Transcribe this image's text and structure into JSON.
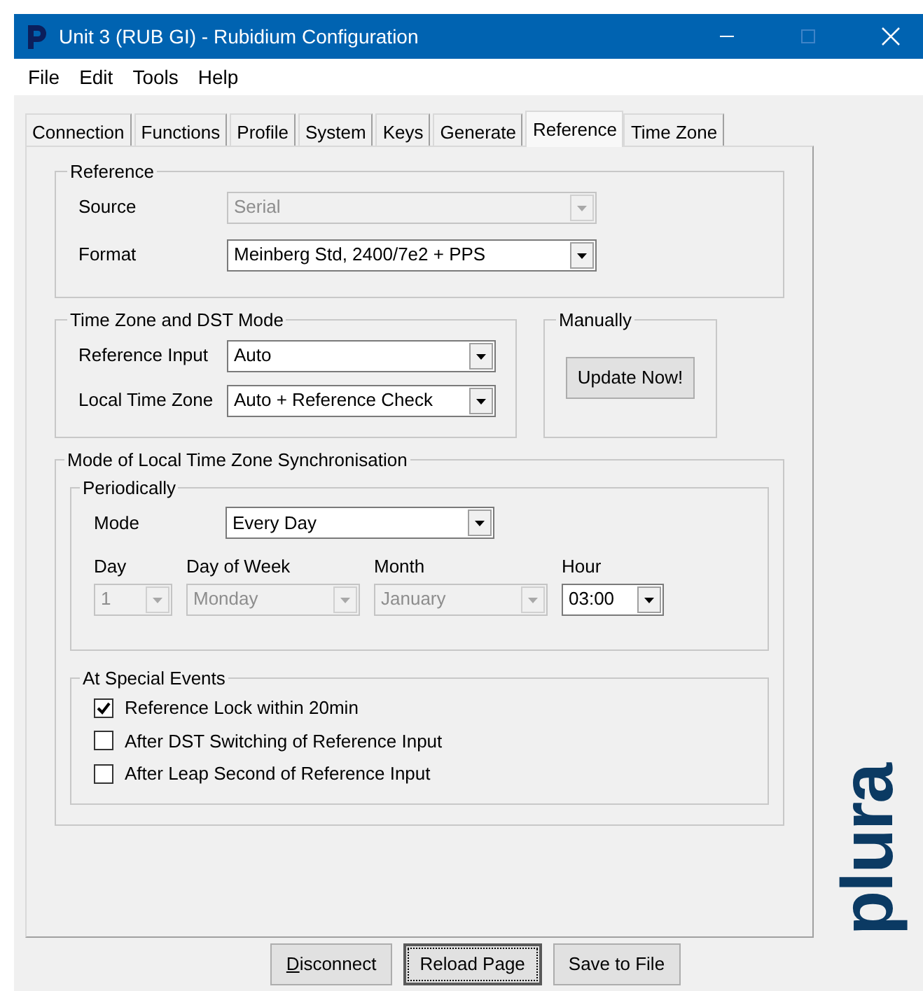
{
  "window": {
    "title": "Unit 3 (RUB GI) - Rubidium Configuration"
  },
  "menu": [
    "File",
    "Edit",
    "Tools",
    "Help"
  ],
  "tabs": [
    {
      "label": "Connection",
      "selected": false
    },
    {
      "label": "Functions",
      "selected": false
    },
    {
      "label": "Profile",
      "selected": false
    },
    {
      "label": "System",
      "selected": false
    },
    {
      "label": "Keys",
      "selected": false
    },
    {
      "label": "Generate",
      "selected": false
    },
    {
      "label": "Reference",
      "selected": true
    },
    {
      "label": "Time Zone",
      "selected": false
    }
  ],
  "reference": {
    "title": "Reference",
    "fields": [
      {
        "label": "Source",
        "value": "Serial",
        "disabled": true
      },
      {
        "label": "Format",
        "value": "Meinberg Std, 2400/7e2 + PPS",
        "disabled": false
      }
    ]
  },
  "time_zone_dst": {
    "title": "Time Zone and DST Mode",
    "fields": [
      {
        "label": "Reference Input",
        "value": "Auto",
        "disabled": false
      },
      {
        "label": "Local Time Zone",
        "value": "Auto + Reference Check",
        "disabled": false
      }
    ]
  },
  "manually": {
    "title": "Manually",
    "button": "Update Now!"
  },
  "sync": {
    "title": "Mode of Local Time Zone Synchronisation",
    "periodically": {
      "title": "Periodically",
      "mode": {
        "label": "Mode",
        "value": "Every Day",
        "disabled": false
      },
      "fields": [
        {
          "label": "Day",
          "value": "1",
          "disabled": true
        },
        {
          "label": "Day of Week",
          "value": "Monday",
          "disabled": true
        },
        {
          "label": "Month",
          "value": "January",
          "disabled": true
        },
        {
          "label": "Hour",
          "value": "03:00",
          "disabled": false
        }
      ]
    },
    "special_events": {
      "title": "At Special Events",
      "options": [
        {
          "label": "Reference Lock within 20min",
          "checked": true
        },
        {
          "label": "After DST Switching of Reference Input",
          "checked": false
        },
        {
          "label": "After Leap Second of Reference Input",
          "checked": false
        }
      ]
    }
  },
  "logo": "plura",
  "buttons": [
    {
      "label": "Disconnect",
      "mnemonic": true,
      "focused": false
    },
    {
      "label": "Reload Page",
      "mnemonic": false,
      "focused": true
    },
    {
      "label": "Save to File",
      "mnemonic": false,
      "focused": false
    }
  ]
}
